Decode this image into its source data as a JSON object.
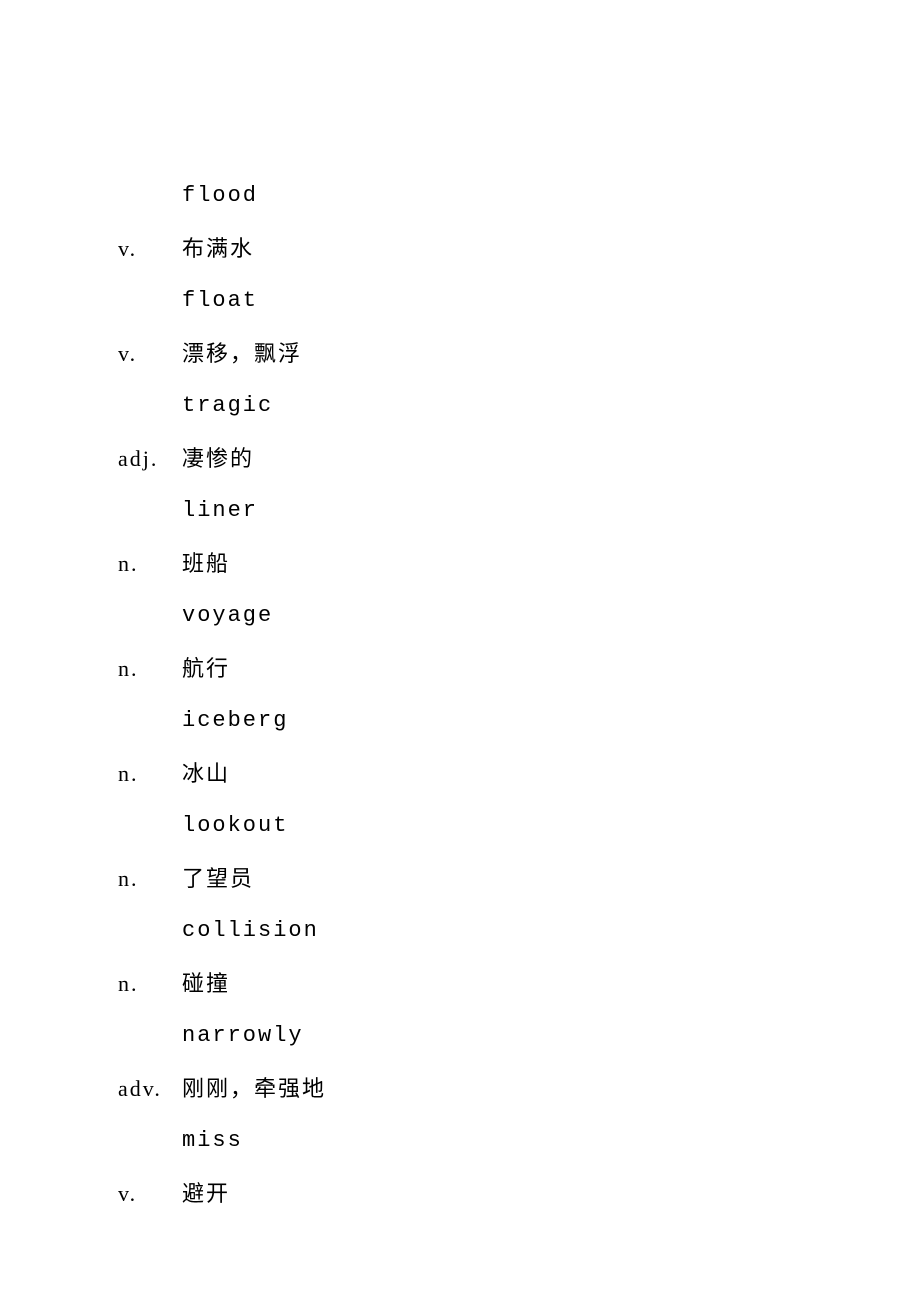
{
  "entries": [
    {
      "word": "flood",
      "pos": "v.",
      "def": "布满水"
    },
    {
      "word": "float",
      "pos": "v.",
      "def": "漂移，飘浮"
    },
    {
      "word": "tragic",
      "pos": "adj.",
      "def": "凄惨的"
    },
    {
      "word": "liner",
      "pos": "n.",
      "def": "班船"
    },
    {
      "word": "voyage",
      "pos": "n.",
      "def": "航行"
    },
    {
      "word": "iceberg",
      "pos": "n.",
      "def": "冰山"
    },
    {
      "word": "lookout",
      "pos": "n.",
      "def": "了望员"
    },
    {
      "word": "collision",
      "pos": "n.",
      "def": "碰撞"
    },
    {
      "word": "narrowly",
      "pos": "adv.",
      "def": "刚刚，牵强地"
    },
    {
      "word": "miss",
      "pos": "v.",
      "def": "避开"
    }
  ]
}
